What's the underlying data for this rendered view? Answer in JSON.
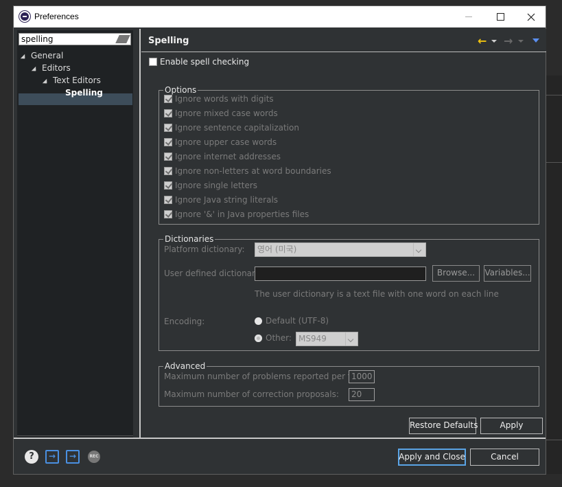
{
  "window": {
    "title": "Preferences"
  },
  "filter": {
    "value": "spelling"
  },
  "tree": [
    {
      "label": "General",
      "level": 0,
      "expanded": true
    },
    {
      "label": "Editors",
      "level": 1,
      "expanded": true
    },
    {
      "label": "Text Editors",
      "level": 2,
      "expanded": true
    },
    {
      "label": "Spelling",
      "level": 3,
      "selected": true
    }
  ],
  "page": {
    "title": "Spelling",
    "enable_label": "Enable spell checking",
    "options": {
      "legend": "Options",
      "items": [
        "Ignore words with digits",
        "Ignore mixed case words",
        "Ignore sentence capitalization",
        "Ignore upper case words",
        "Ignore internet addresses",
        "Ignore non-letters at word boundaries",
        "Ignore single letters",
        "Ignore Java string literals",
        "Ignore '&' in Java properties files"
      ]
    },
    "dictionaries": {
      "legend": "Dictionaries",
      "platform_label": "Platform dictionary:",
      "platform_value": "영어 (미국)",
      "user_label": "User defined dictionary:",
      "user_value": "",
      "browse": "Browse...",
      "variables": "Variables...",
      "hint": "The user dictionary is a text file with one word on each line",
      "encoding_label": "Encoding:",
      "default_label": "Default (UTF-8)",
      "other_label": "Other:",
      "other_value": "MS949"
    },
    "advanced": {
      "legend": "Advanced",
      "max_problems_label": "Maximum number of problems reported per file:",
      "max_problems_value": "1000",
      "max_corrections_label": "Maximum number of correction proposals:",
      "max_corrections_value": "20"
    },
    "restore_defaults": "Restore Defaults",
    "apply": "Apply"
  },
  "footer": {
    "apply_close": "Apply and Close",
    "cancel": "Cancel",
    "rec_label": "REC"
  }
}
